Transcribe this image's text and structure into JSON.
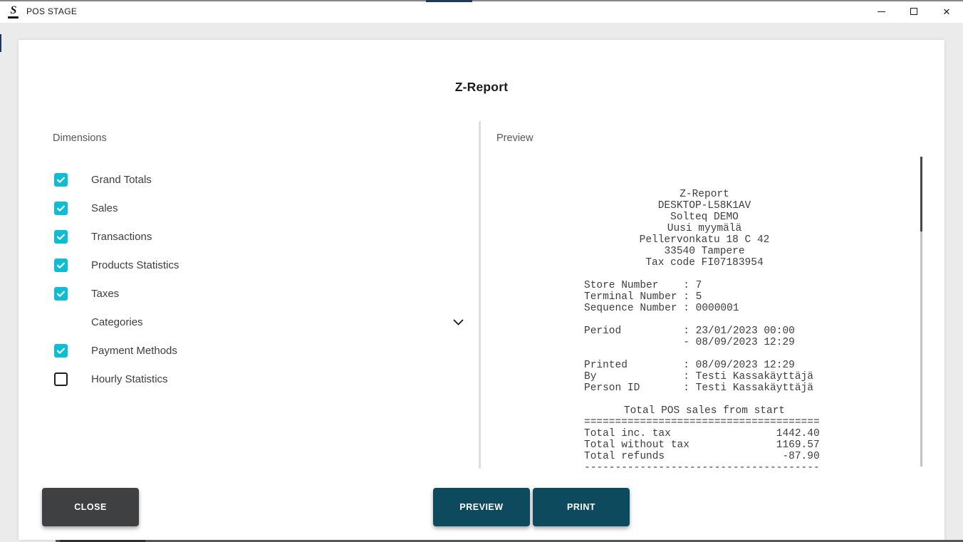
{
  "window": {
    "app_title": "POS STAGE",
    "controls": {
      "minimize": "minimize",
      "maximize": "maximize",
      "close": "✕"
    }
  },
  "page": {
    "title": "Z-Report"
  },
  "dimensions_panel": {
    "heading": "Dimensions",
    "items": [
      {
        "label": "Grand Totals",
        "type": "checkbox",
        "checked": true
      },
      {
        "label": "Sales",
        "type": "checkbox",
        "checked": true
      },
      {
        "label": "Transactions",
        "type": "checkbox",
        "checked": true
      },
      {
        "label": "Products Statistics",
        "type": "checkbox",
        "checked": true
      },
      {
        "label": "Taxes",
        "type": "checkbox",
        "checked": true
      },
      {
        "label": "Categories",
        "type": "expander",
        "icon": "chevron-down-icon"
      },
      {
        "label": "Payment Methods",
        "type": "checkbox",
        "checked": true
      },
      {
        "label": "Hourly Statistics",
        "type": "checkbox",
        "checked": false
      }
    ]
  },
  "preview_panel": {
    "heading": "Preview",
    "receipt": {
      "title": "Z-Report",
      "header_lines": [
        "DESKTOP-L58K1AV",
        "Solteq DEMO",
        "Uusi myymälä",
        "Pellervonkatu 18 C 42",
        "33540 Tampere",
        "Tax code FI07183954"
      ],
      "detail_lines": [
        "Store Number    : 7",
        "Terminal Number : 5",
        "Sequence Number : 0000001",
        "",
        "Period          : 23/01/2023 00:00",
        "                - 08/09/2023 12:29",
        "",
        "Printed         : 08/09/2023 12:29",
        "By              : Testi Kassakäyttäjä",
        "Person ID       : Testi Kassakäyttäjä"
      ],
      "section_title": "Total POS sales from start",
      "totals_lines": [
        "======================================",
        "Total inc. tax                 1442.40",
        "Total without tax              1169.57",
        "Total refunds                   -87.90",
        "--------------------------------------"
      ]
    }
  },
  "footer": {
    "close_label": "CLOSE",
    "preview_label": "PREVIEW",
    "print_label": "PRINT"
  },
  "colors": {
    "checkbox_accent": "#0fbdd3",
    "button_dark": "#3f4042",
    "button_teal": "#0e4a5e",
    "top_accent_navy": "#1d3a5e",
    "background_gray": "#ebebeb"
  }
}
